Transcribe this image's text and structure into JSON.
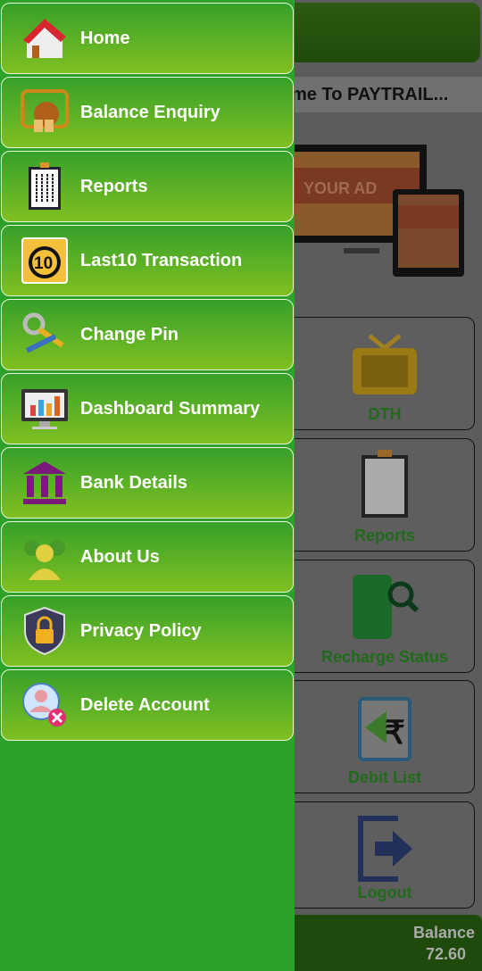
{
  "background": {
    "marquee": "me To PAYTRAIL...",
    "ad_text": "YOUR AD",
    "tiles": [
      {
        "label": "DTH",
        "icon": "tv-icon"
      },
      {
        "label": "Reports",
        "icon": "clipboard-icon"
      },
      {
        "label": "Recharge Status",
        "icon": "phone-search-icon"
      },
      {
        "label": "Debit List",
        "icon": "rupee-clipboard-icon"
      },
      {
        "label": "Logout",
        "icon": "logout-icon"
      }
    ],
    "balance_label": "Balance",
    "balance_value": "72.60"
  },
  "drawer": {
    "items": [
      {
        "label": "Home",
        "icon": "home-icon"
      },
      {
        "label": "Balance Enquiry",
        "icon": "money-bag-icon"
      },
      {
        "label": "Reports",
        "icon": "clipboard-icon"
      },
      {
        "label": "Last10 Transaction",
        "icon": "calendar-10-icon"
      },
      {
        "label": "Change Pin",
        "icon": "key-pencil-icon"
      },
      {
        "label": "Dashboard Summary",
        "icon": "monitor-chart-icon"
      },
      {
        "label": "Bank Details",
        "icon": "bank-icon"
      },
      {
        "label": "About Us",
        "icon": "users-icon"
      },
      {
        "label": "Privacy Policy",
        "icon": "shield-lock-icon"
      },
      {
        "label": "Delete Account",
        "icon": "user-delete-icon"
      }
    ]
  },
  "colors": {
    "drawer": "#2ea12a",
    "item_top": "#36a02a",
    "item_bottom": "#80c021"
  }
}
